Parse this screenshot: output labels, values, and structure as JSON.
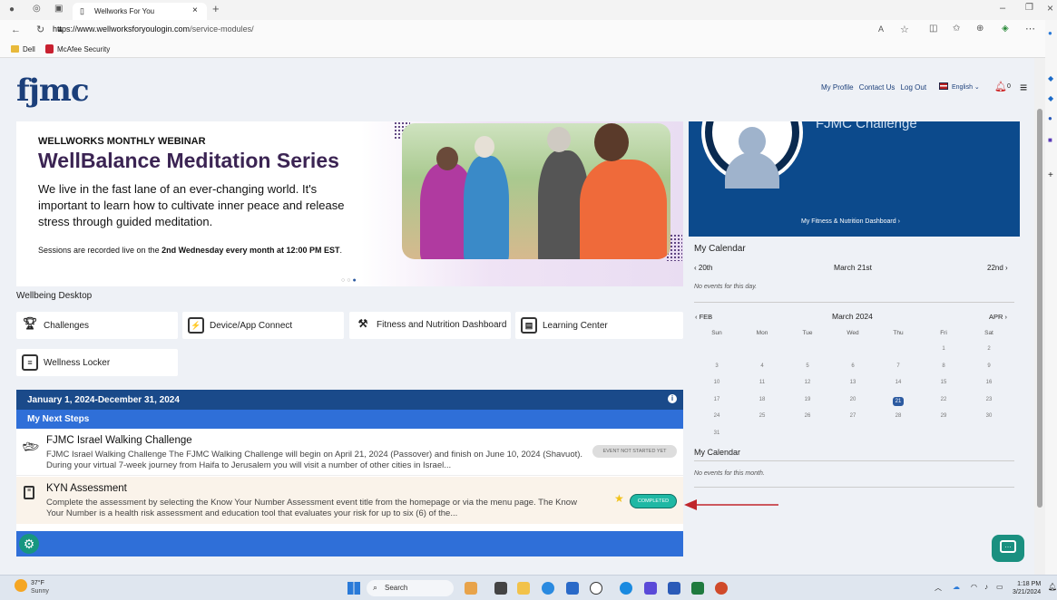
{
  "browser": {
    "tab_title": "Wellworks For You",
    "url_host": "https://www.wellworksforyoulogin.com",
    "url_path": "/service-modules/",
    "favorites": [
      "Dell",
      "McAfee Security"
    ]
  },
  "header": {
    "logo": "fjmc",
    "links": [
      "My Profile",
      "Contact Us",
      "Log Out"
    ],
    "language": "English",
    "notif_count": "0"
  },
  "banner": {
    "kicker": "WELLWORKS MONTHLY WEBINAR",
    "title": "WellBalance Meditation Series",
    "body": "We live in the fast lane of an ever-changing world. It's important to learn how to cultivate inner peace and release stress through guided meditation.",
    "sessions_prefix": "Sessions are recorded live on the ",
    "sessions_bold": "2nd Wednesday every month at 12:00 PM EST",
    "sessions_suffix": "."
  },
  "wellbeing": {
    "title": "Wellbeing Desktop",
    "tiles": [
      "Challenges",
      "Device/App Connect",
      "Fitness and Nutrition Dashboard",
      "Learning Center",
      "Wellness Locker"
    ]
  },
  "next_steps": {
    "date_range": "January 1, 2024-December 31, 2024",
    "heading": "My Next Steps",
    "items": [
      {
        "title": "FJMC Israel Walking Challenge",
        "desc": "FJMC Israel Walking Challenge The FJMC Walking Challenge will begin on April 21, 2024 (Passover) and finish on June 10, 2024 (Shavuot). During your virtual 7-week journey from Haifa to Jerusalem you will visit a number of other cities in Israel...",
        "status": "EVENT NOT STARTED YET"
      },
      {
        "title": "KYN Assessment",
        "desc": "Complete the assessment by selecting the Know Your Number Assessment event title from the homepage or via the menu page. The Know Your Number is a health risk assessment and education tool that evaluates your risk for up to six (6) of the...",
        "status": "COMPLETED"
      }
    ]
  },
  "profile": {
    "name": "FJMC Challenge",
    "dashboard_link": "My Fitness & Nutrition Dashboard"
  },
  "calendar": {
    "title": "My Calendar",
    "prev_day": "20th",
    "current_day": "March 21st",
    "next_day": "22nd",
    "no_events_day": "No events for this day.",
    "prev_month": "FEB",
    "month": "March 2024",
    "next_month": "APR",
    "weekdays": [
      "Sun",
      "Mon",
      "Tue",
      "Wed",
      "Thu",
      "Fri",
      "Sat"
    ],
    "weeks": [
      [
        "",
        "",
        "",
        "",
        "",
        "1",
        "2"
      ],
      [
        "3",
        "4",
        "5",
        "6",
        "7",
        "8",
        "9"
      ],
      [
        "10",
        "11",
        "12",
        "13",
        "14",
        "15",
        "16"
      ],
      [
        "17",
        "18",
        "19",
        "20",
        "21",
        "22",
        "23"
      ],
      [
        "24",
        "25",
        "26",
        "27",
        "28",
        "29",
        "30"
      ],
      [
        "31",
        "",
        "",
        "",
        "",
        "",
        ""
      ]
    ],
    "today": "21",
    "month_title": "My Calendar",
    "no_events_month": "No events for this month."
  },
  "taskbar": {
    "weather_temp": "37°F",
    "weather_desc": "Sunny",
    "search": "Search",
    "time": "1:18 PM",
    "date": "3/21/2024"
  },
  "colors": {
    "brand_navy": "#1a4a8a",
    "brand_blue": "#2f6fd8",
    "completed": "#1fb8a4",
    "annotation_arrow": "#c0262b"
  }
}
